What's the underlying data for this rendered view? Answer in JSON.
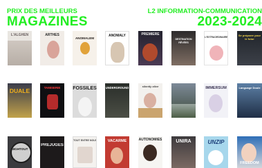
{
  "header": {
    "prize_label": "PRIX DES MEILLEURS",
    "title": "MAGAZINES",
    "program_label": "L2 INFORMATION-COMMUNICATION",
    "year": "2023-2024"
  },
  "colors": {
    "accent": "#22ee22",
    "background": "#ffffff"
  },
  "covers": [
    {
      "title": "L'ALGHEN"
    },
    {
      "title": "ARTHÉS"
    },
    {
      "title": "ANOMALEM"
    },
    {
      "title": "ANOMALY"
    },
    {
      "title": "PREMIÈRE"
    },
    {
      "title": "DESTINATION RÊVÉES"
    },
    {
      "title": "L'EXTRAORDINAIRE"
    },
    {
      "title": ""
    },
    {
      "title": "Se préparer pour le futur"
    },
    {
      "title": "DUALE"
    },
    {
      "title": "TAMISERIE"
    },
    {
      "title": "FOSSILES"
    },
    {
      "title": "UNDERGROUND"
    },
    {
      "title": "silently alive"
    },
    {
      "title": ""
    },
    {
      "title": "IMMERSUM"
    },
    {
      "title": "Language Doule"
    },
    {
      "title": "NIGHTOUT"
    },
    {
      "title": "PREJUGÉS"
    },
    {
      "title": "TOUT ENTRE NOUS"
    },
    {
      "title": "VACARME"
    },
    {
      "title": "AUTONOMIES"
    },
    {
      "title": "UNIRA"
    },
    {
      "title": "UNZIP"
    },
    {
      "title": "FREEDOM"
    }
  ]
}
